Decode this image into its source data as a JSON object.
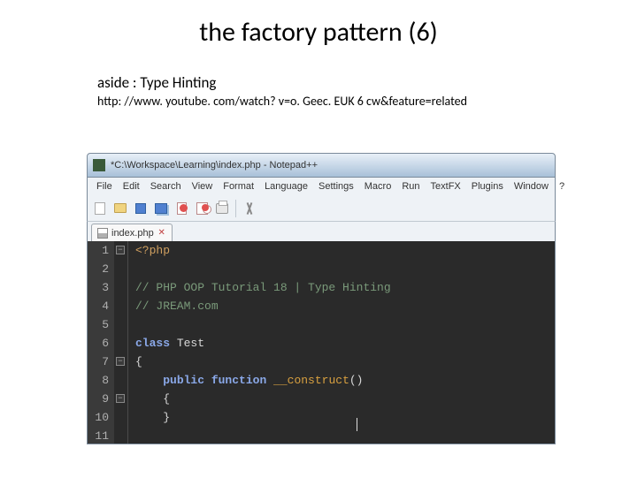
{
  "slide": {
    "title": "the factory pattern (6)",
    "subtitle": "aside : Type Hinting",
    "link": "http: //www. youtube. com/watch? v=o. Geec. EUK 6 cw&feature=related"
  },
  "window": {
    "title": "*C:\\Workspace\\Learning\\index.php - Notepad++"
  },
  "menu": [
    "File",
    "Edit",
    "Search",
    "View",
    "Format",
    "Language",
    "Settings",
    "Macro",
    "Run",
    "TextFX",
    "Plugins",
    "Window",
    "?"
  ],
  "tab": {
    "label": "index.php",
    "close": "✕"
  },
  "gutter_lines": [
    "1",
    "2",
    "3",
    "4",
    "5",
    "6",
    "7",
    "8",
    "9",
    "10",
    "11"
  ],
  "code": {
    "l1": "<?php",
    "l3a": "// PHP OOP Tutorial 18 | Type Hinting",
    "l4a": "// JREAM.com",
    "l6_class": "class",
    "l6_name": " Test",
    "l7": "{",
    "l8_pub": "public",
    "l8_fun": " function",
    "l8_name": " __construct",
    "l8_par": "()",
    "l9": "{",
    "l10": "}"
  }
}
